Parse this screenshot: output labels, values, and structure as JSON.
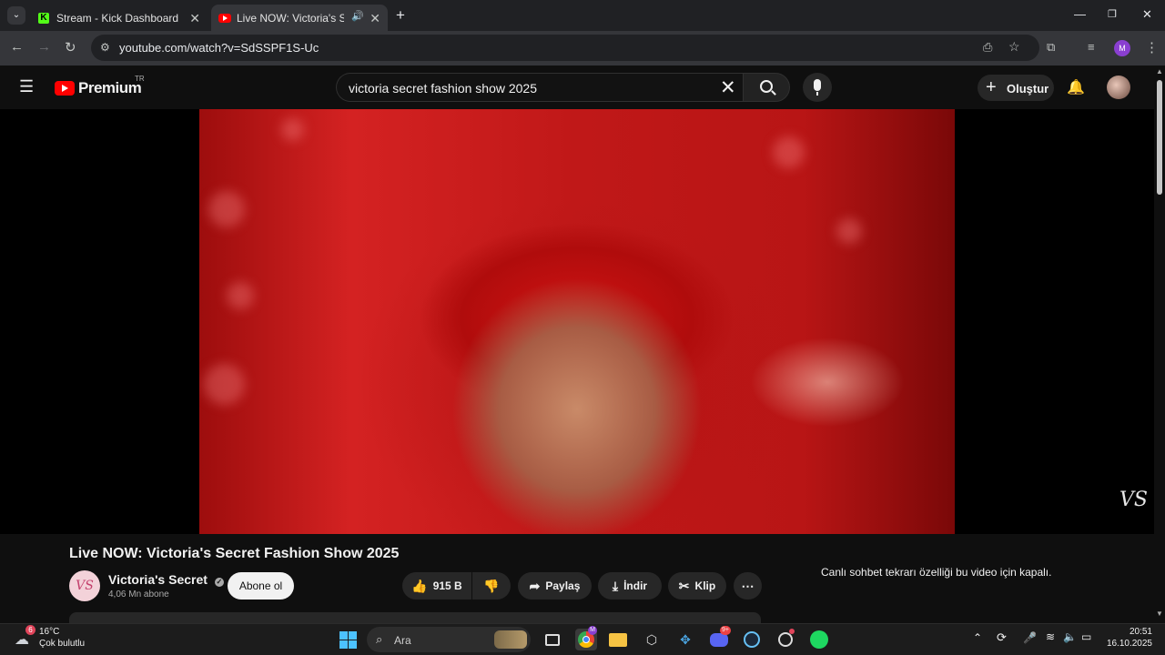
{
  "browser": {
    "tabs": [
      {
        "title": "Stream - Kick Dashboard",
        "favicon": "kick-icon",
        "active": false
      },
      {
        "title": "Live NOW: Victoria's Secret",
        "favicon": "youtube-icon",
        "active": true
      }
    ],
    "url": "youtube.com/watch?v=SdSSPF1S-Uc",
    "profile_initial": "M"
  },
  "youtube": {
    "logo_text": "Premium",
    "region": "TR",
    "search_query": "victoria secret fashion show 2025",
    "create_label": "Oluştur"
  },
  "video": {
    "title": "Live NOW: Victoria's Secret Fashion Show 2025",
    "watermark": "VS",
    "channel": {
      "name": "Victoria's Secret",
      "verified": true,
      "subscribers": "4,06 Mn abone",
      "avatar_text": "VS"
    },
    "subscribe_label": "Abone ol",
    "actions": {
      "likes": "915 B",
      "share": "Paylaş",
      "download": "İndir",
      "clip": "Klip"
    },
    "chat_status": "Canlı sohbet tekrarı özelliği bu video için kapalı."
  },
  "taskbar": {
    "weather": {
      "temp": "16°C",
      "condition": "Çok bulutlu",
      "badge": "6"
    },
    "search_label": "Ara",
    "clock": {
      "time": "20:51",
      "date": "16.10.2025"
    },
    "badges": {
      "chrome": "M",
      "discord": "9+"
    }
  },
  "colors": {
    "youtube_red": "#ff0000",
    "background": "#0f0f0f",
    "kick_green": "#53fc18",
    "spotify_green": "#1ed760"
  }
}
